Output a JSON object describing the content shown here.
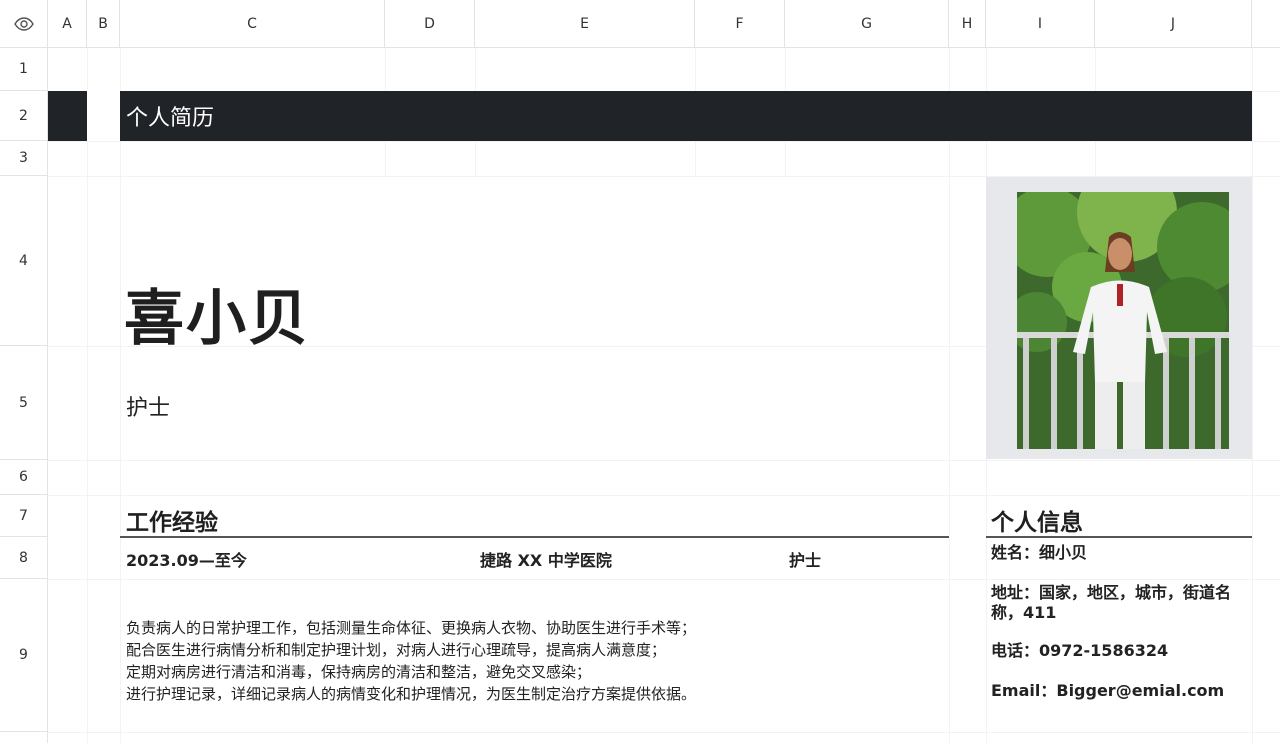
{
  "headers": {
    "columns": [
      "A",
      "B",
      "C",
      "D",
      "E",
      "F",
      "G",
      "H",
      "I",
      "J"
    ],
    "rows": [
      "1",
      "2",
      "3",
      "4",
      "5",
      "6",
      "7",
      "8",
      "9"
    ]
  },
  "resume": {
    "title": "个人简历",
    "name": "喜小贝",
    "role": "护士"
  },
  "experience": {
    "heading": "工作经验",
    "period": "2023.09—至今",
    "employer": "捷路 XX 中学医院",
    "position": "护士",
    "duties": [
      "负责病人的日常护理工作，包括测量生命体征、更换病人衣物、协助医生进行手术等；",
      "配合医生进行病情分析和制定护理计划，对病人进行心理疏导，提高病人满意度；",
      "定期对病房进行清洁和消毒，保持病房的清洁和整洁，避免交叉感染；",
      "进行护理记录，详细记录病人的病情变化和护理情况，为医生制定治疗方案提供依据。"
    ]
  },
  "personal_info": {
    "heading": "个人信息",
    "name_line": "姓名：细小贝",
    "address_line1": "地址：国家，地区，城市，街道名",
    "address_line2": "称，411",
    "phone_line": "电话：0972-1586324",
    "email_line": "Email：Bigger@emial.com"
  },
  "icons": {
    "corner": "eye-icon",
    "photo": "nurse-portrait-photo"
  },
  "colors": {
    "title_bar": "#202328",
    "photo_bg": "#e6e8ec"
  }
}
